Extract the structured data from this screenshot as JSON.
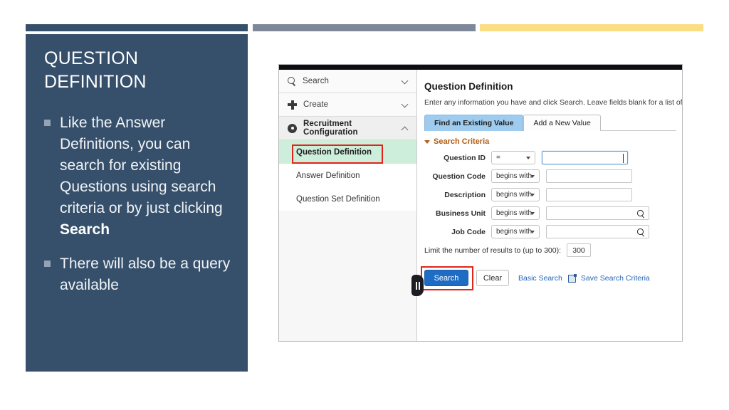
{
  "slide": {
    "title": "QUESTION\nDEFINITION",
    "bullets": [
      {
        "text_before": "Like the Answer Definitions, you can search for existing Questions using search criteria or by just clicking ",
        "bold": "Search",
        "text_after": ""
      },
      {
        "text_before": "There will also be a query available",
        "bold": "",
        "text_after": ""
      }
    ],
    "bars": {
      "navy": "#36506b",
      "gray": "#7f8899",
      "gold": "#fbdd83"
    }
  },
  "app": {
    "nav": {
      "items": [
        {
          "label": "Search",
          "icon": "search-icon",
          "chevron": "chevron-down-icon"
        },
        {
          "label": "Create",
          "icon": "plus-icon",
          "chevron": "chevron-down-icon"
        },
        {
          "label": "Recruitment Configuration",
          "icon": "gear-icon",
          "chevron": "chevron-up-icon"
        }
      ],
      "sub_items": [
        {
          "label": "Question Definition",
          "selected": true
        },
        {
          "label": "Answer Definition",
          "selected": false
        },
        {
          "label": "Question Set Definition",
          "selected": false
        }
      ],
      "highlight_color": "#e2231a",
      "selected_bg": "#cdeeda"
    },
    "main": {
      "heading": "Question Definition",
      "description": "Enter any information you have and click Search. Leave fields blank for a list of all",
      "tabs": [
        {
          "label": "Find an Existing Value",
          "active": true
        },
        {
          "label": "Add a New Value",
          "active": false,
          "underline_first": "A"
        }
      ],
      "section_label": "Search Criteria",
      "section_color": "#b35c13",
      "fields": [
        {
          "label": "Question ID",
          "operator": "=",
          "value": "",
          "lookup": false,
          "focused": true
        },
        {
          "label": "Question Code",
          "operator": "begins with",
          "value": "",
          "lookup": false,
          "focused": false
        },
        {
          "label": "Description",
          "operator": "begins with",
          "value": "",
          "lookup": false,
          "focused": false
        },
        {
          "label": "Business Unit",
          "operator": "begins with",
          "value": "",
          "lookup": true,
          "focused": false
        },
        {
          "label": "Job Code",
          "operator": "begins with",
          "value": "",
          "lookup": true,
          "focused": false
        }
      ],
      "limit_label": "Limit the number of results to (up to 300):",
      "limit_value": "300",
      "actions": {
        "search_label": "Search",
        "clear_label": "Clear",
        "basic_search_label": "Basic Search",
        "save_criteria_label": "Save Search Criteria",
        "search_button_color": "#1f6cc4",
        "link_color": "#2266bb"
      },
      "collapse_handle": "collapse-panel-handle"
    }
  }
}
